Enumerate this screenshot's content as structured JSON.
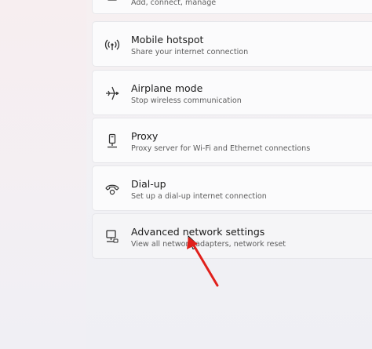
{
  "cards": [
    {
      "id": "network-and-internet-prev",
      "title": "",
      "desc": "Add, connect, manage",
      "icon": "ethernet-icon"
    },
    {
      "id": "mobile-hotspot",
      "title": "Mobile hotspot",
      "desc": "Share your internet connection",
      "icon": "hotspot-icon"
    },
    {
      "id": "airplane-mode",
      "title": "Airplane mode",
      "desc": "Stop wireless communication",
      "icon": "airplane-icon"
    },
    {
      "id": "proxy",
      "title": "Proxy",
      "desc": "Proxy server for Wi-Fi and Ethernet connections",
      "icon": "proxy-icon"
    },
    {
      "id": "dial-up",
      "title": "Dial-up",
      "desc": "Set up a dial-up internet connection",
      "icon": "dialup-phone-icon"
    },
    {
      "id": "advanced-network-settings",
      "title": "Advanced network settings",
      "desc": "View all network adapters, network reset",
      "icon": "network-monitor-icon"
    }
  ],
  "annotation": {
    "arrow_color": "#e0201b"
  }
}
